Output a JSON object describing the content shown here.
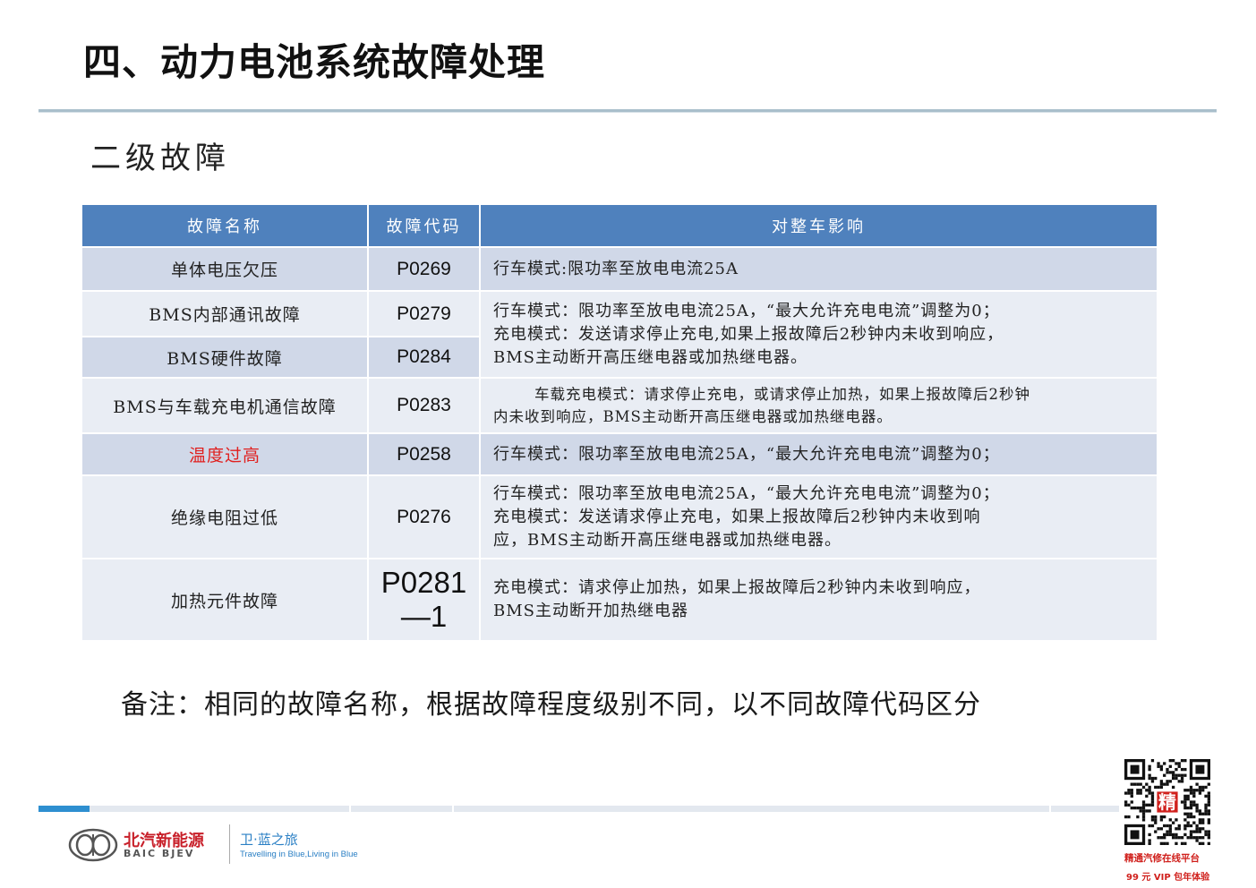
{
  "page": {
    "title": "四、动力电池系统故障处理",
    "section_title": "二级故障",
    "note": "备注：相同的故障名称，根据故障程度级别不同，以不同故障代码区分"
  },
  "table": {
    "headers": [
      "故障名称",
      "故障代码",
      "对整车影响"
    ],
    "rows": [
      {
        "name": "单体电压欠压",
        "code": "P0269",
        "effect": [
          "行车模式:限功率至放电电流25A"
        ]
      },
      {
        "name": "BMS内部通讯故障",
        "code": "P0279",
        "effect": [
          "行车模式：限功率至放电电流25A，“最大允许充电电流”调整为0；",
          "充电模式：发送请求停止充电,如果上报故障后2秒钟内未收到响应，",
          "BMS主动断开高压继电器或加热继电器。"
        ]
      },
      {
        "name": "BMS硬件故障",
        "code": "P0284"
      },
      {
        "name": "BMS与车载充电机通信故障",
        "code": "P0283",
        "effect": [
          "车载充电模式：请求停止充电，或请求停止加热，如果上报故障后2秒钟",
          "内未收到响应，BMS主动断开高压继电器或加热继电器。"
        ]
      },
      {
        "name": "温度过高",
        "code": "P0258",
        "effect": [
          "行车模式：限功率至放电电流25A，“最大允许充电电流”调整为0；"
        ]
      },
      {
        "name": "绝缘电阻过低",
        "code": "P0276",
        "effect": [
          "行车模式：限功率至放电电流25A，“最大允许充电电流”调整为0；",
          "充电模式：发送请求停止充电，如果上报故障后2秒钟内未收到响",
          "应，BMS主动断开高压继电器或加热继电器。"
        ]
      },
      {
        "name": "加热元件故障",
        "code": [
          "P0281",
          "—1"
        ],
        "effect": [
          "充电模式：请求停止加热，如果上报故障后2秒钟内未收到响应，",
          "BMS主动断开加热继电器"
        ]
      }
    ]
  },
  "footer": {
    "brand_cn": "北汽新能源",
    "brand_en": "BAIC BJEV",
    "slogan_cn": "卫·蓝之旅",
    "slogan_en": "Travelling in Blue,Living in Blue",
    "qr_caption_line1": "精通汽修在线平台",
    "qr_caption_line2": "99 元 VIP 包年体验",
    "qr_badge": "精"
  },
  "colors": {
    "header_bg": "#4f81bd",
    "row_dark": "#d0d8e8",
    "row_light": "#e9edf4",
    "highlight_red": "#e0201f",
    "accent_blue": "#2e8fd0"
  }
}
